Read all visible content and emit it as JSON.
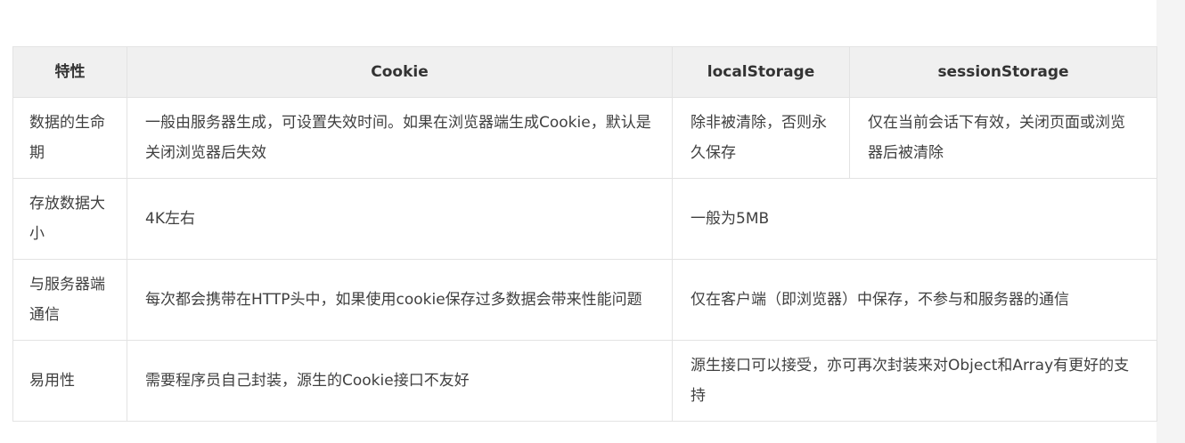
{
  "table": {
    "headers": [
      "特性",
      "Cookie",
      "localStorage",
      "sessionStorage"
    ],
    "rows": [
      {
        "feature": "数据的生命期",
        "cookie": "一般由服务器生成，可设置失效时间。如果在浏览器端生成Cookie，默认是关闭浏览器后失效",
        "localStorage": "除非被清除，否则永久保存",
        "sessionStorage": "仅在当前会话下有效，关闭页面或浏览器后被清除"
      },
      {
        "feature": "存放数据大小",
        "cookie": "4K左右",
        "storage": "一般为5MB"
      },
      {
        "feature": "与服务器端通信",
        "cookie": "每次都会携带在HTTP头中，如果使用cookie保存过多数据会带来性能问题",
        "storage": "仅在客户端（即浏览器）中保存，不参与和服务器的通信"
      },
      {
        "feature": "易用性",
        "cookie": "需要程序员自己封装，源生的Cookie接口不友好",
        "storage": "源生接口可以接受，亦可再次封装来对Object和Array有更好的支持"
      }
    ]
  }
}
